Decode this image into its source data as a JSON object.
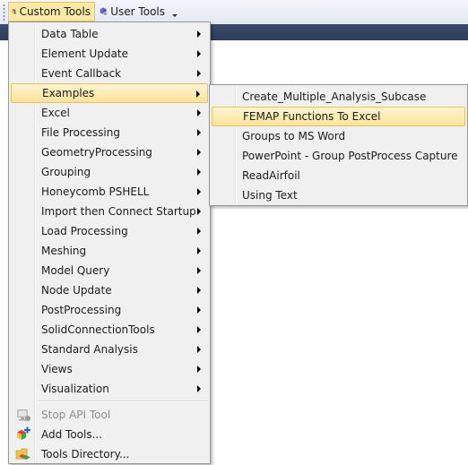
{
  "toolbar": {
    "custom_tools_label": "Custom Tools",
    "user_tools_label": "User Tools"
  },
  "main_menu": {
    "items": [
      {
        "label": "Data Table",
        "submenu": true
      },
      {
        "label": "Element Update",
        "submenu": true
      },
      {
        "label": "Event Callback",
        "submenu": true
      },
      {
        "label": "Examples",
        "submenu": true,
        "highlighted": true
      },
      {
        "label": "Excel",
        "submenu": true
      },
      {
        "label": "File Processing",
        "submenu": true
      },
      {
        "label": "GeometryProcessing",
        "submenu": true
      },
      {
        "label": "Grouping",
        "submenu": true
      },
      {
        "label": "Honeycomb PSHELL",
        "submenu": true
      },
      {
        "label": "Import then Connect Startup",
        "submenu": true
      },
      {
        "label": "Load Processing",
        "submenu": true
      },
      {
        "label": "Meshing",
        "submenu": true
      },
      {
        "label": "Model Query",
        "submenu": true
      },
      {
        "label": "Node Update",
        "submenu": true
      },
      {
        "label": "PostProcessing",
        "submenu": true
      },
      {
        "label": "SolidConnectionTools",
        "submenu": true
      },
      {
        "label": "Standard Analysis",
        "submenu": true
      },
      {
        "label": "Views",
        "submenu": true
      },
      {
        "label": "Visualization",
        "submenu": true
      }
    ],
    "actions": [
      {
        "label": "Stop API Tool",
        "icon": "stop-api-tool-icon",
        "disabled": true
      },
      {
        "label": "Add Tools...",
        "icon": "add-tools-icon",
        "disabled": false
      },
      {
        "label": "Tools Directory...",
        "icon": "tools-directory-icon",
        "disabled": false
      }
    ]
  },
  "submenu_examples": {
    "items": [
      {
        "label": "Create_Multiple_Analysis_Subcase"
      },
      {
        "label": "FEMAP Functions To Excel",
        "highlighted": true
      },
      {
        "label": "Groups to MS Word"
      },
      {
        "label": "PowerPoint - Group PostProcess Capture"
      },
      {
        "label": "ReadAirfoil"
      },
      {
        "label": "Using Text"
      }
    ]
  }
}
